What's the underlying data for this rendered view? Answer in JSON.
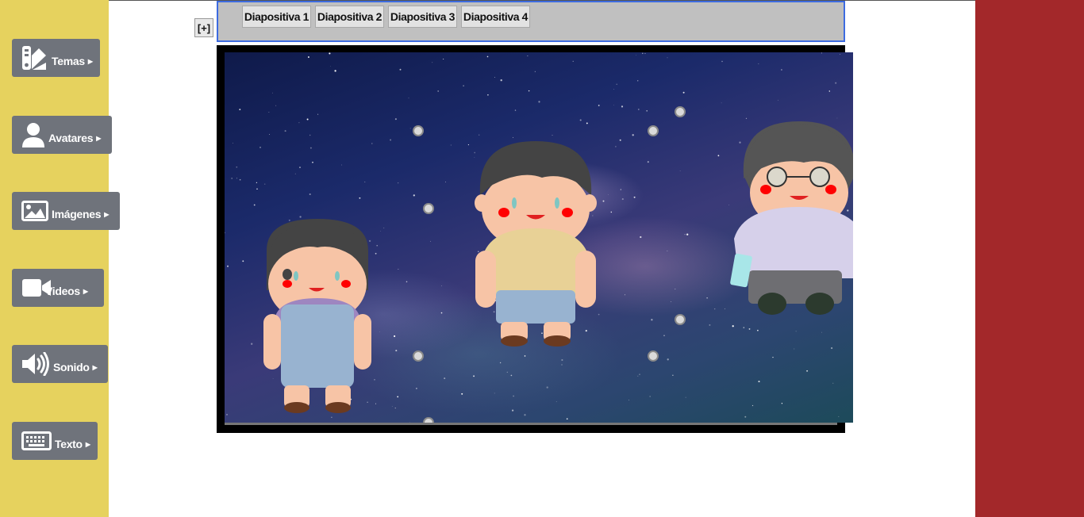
{
  "sidebar": {
    "items": [
      {
        "label": "Temas",
        "icon": "palette-icon"
      },
      {
        "label": "Avatares",
        "icon": "user-icon"
      },
      {
        "label": "Imágenes",
        "icon": "image-icon"
      },
      {
        "label": "Videos",
        "icon": "video-icon"
      },
      {
        "label": "Sonido",
        "icon": "volume-icon"
      },
      {
        "label": "Texto",
        "icon": "keyboard-icon"
      }
    ]
  },
  "toolbar": {
    "add_slide_label": "[+]",
    "slides": [
      {
        "label": "Diapositiva 1"
      },
      {
        "label": "Diapositiva 2"
      },
      {
        "label": "Diapositiva 3"
      },
      {
        "label": "Diapositiva 4"
      }
    ]
  },
  "stage": {
    "background": "starry-galaxy",
    "characters": [
      "girl-avatar",
      "boy-avatar",
      "grandmother-avatar"
    ]
  },
  "colors": {
    "left_panel": "#e6d25e",
    "right_panel": "#a3282a",
    "button": "#6f737b",
    "tabbar_border": "#3d6be0"
  }
}
